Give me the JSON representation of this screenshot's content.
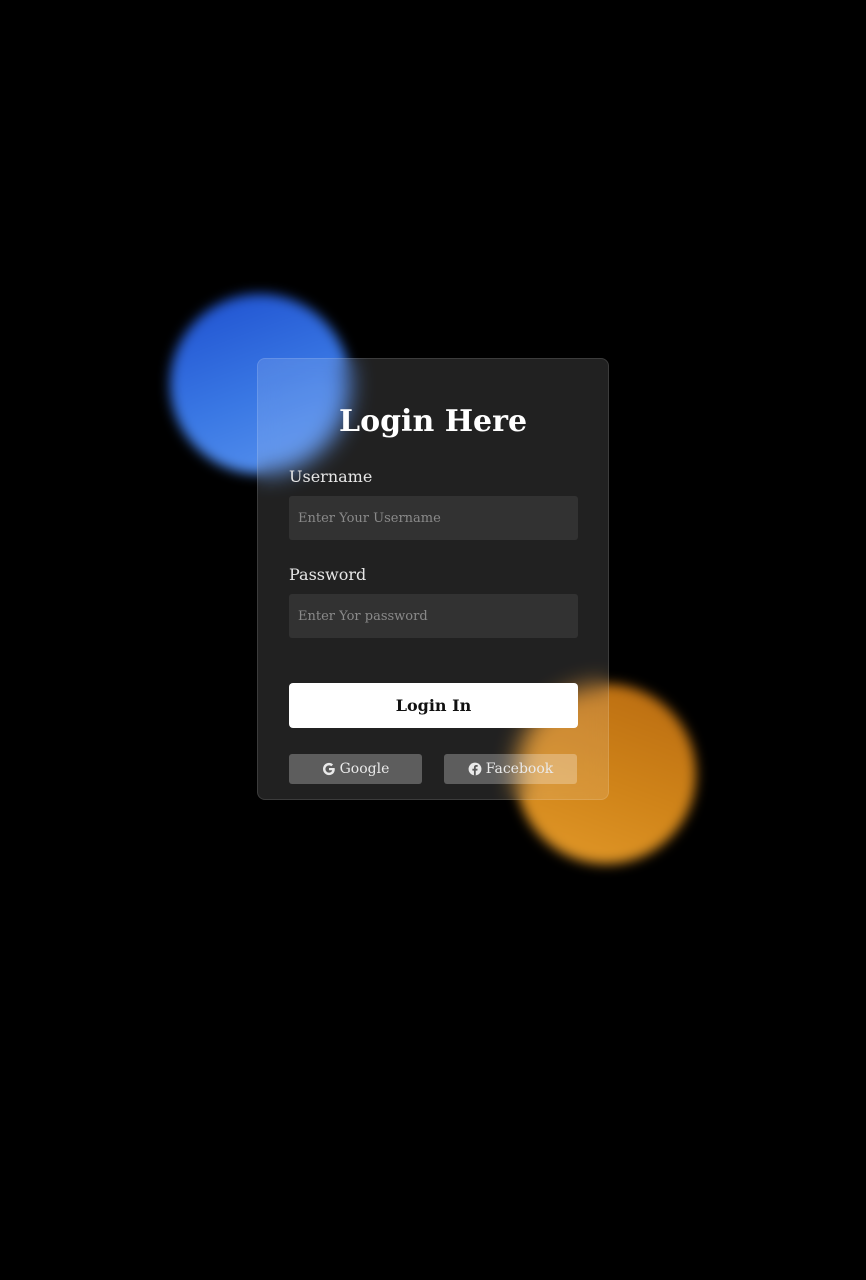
{
  "login": {
    "title": "Login Here",
    "username_label": "Username",
    "username_placeholder": "Enter Your Username",
    "password_label": "Password",
    "password_placeholder": "Enter Yor password",
    "submit_label": "Login In"
  },
  "social": {
    "google_label": "Google",
    "google_icon": "google-icon",
    "facebook_label": "Facebook",
    "facebook_icon": "facebook-icon"
  },
  "colors": {
    "background": "#000000",
    "orb_blue": "#3a78e4",
    "orb_orange": "#d08419",
    "button": "#ffffff"
  }
}
